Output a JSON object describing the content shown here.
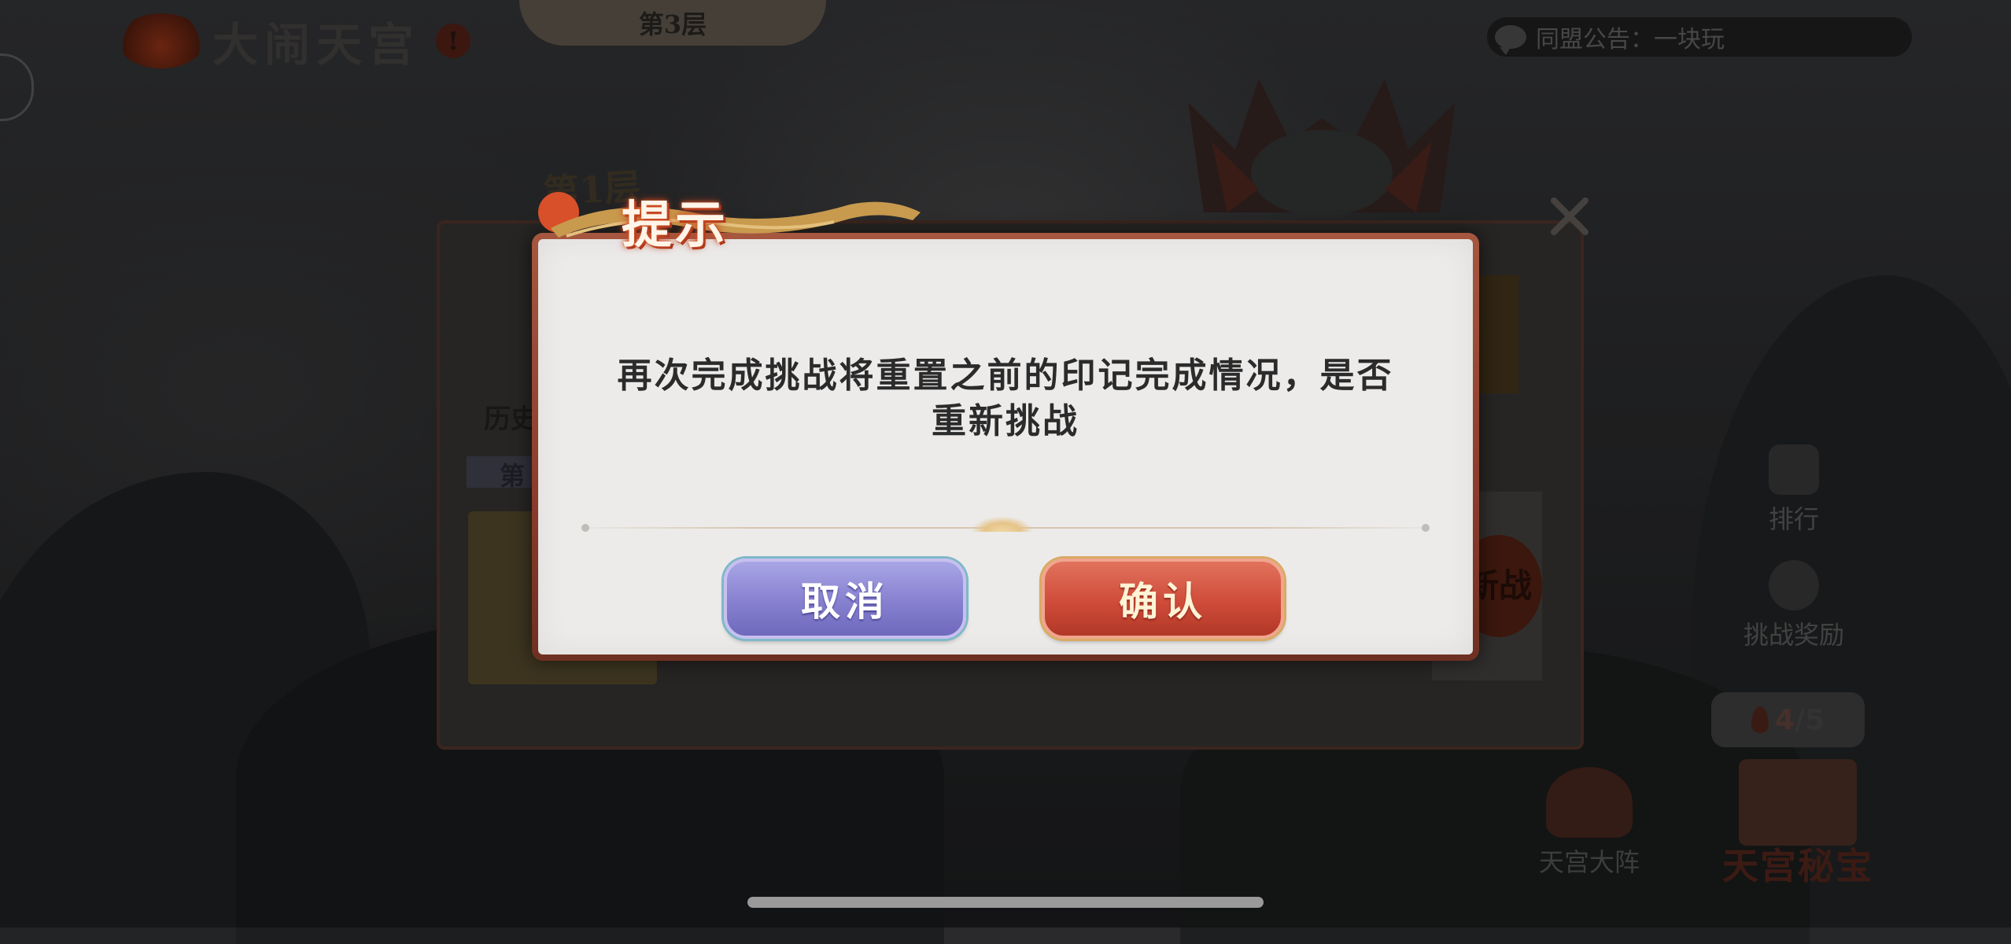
{
  "header": {
    "game_title": "大闹天宫",
    "alert_mark": "!",
    "floor_tab": "第3层",
    "announcement": "同盟公告：一块玩"
  },
  "background_panel": {
    "floor_label": "第1层",
    "history_label": "历史",
    "section_label": "第",
    "challenge_seal": "新战",
    "close_icon": "close-icon"
  },
  "side_menu": {
    "ranking_label": "排行",
    "reward_label": "挑战奖励",
    "stamina_current": "4",
    "stamina_max": "/5",
    "formation_label": "天宫大阵",
    "treasure_label": "天宫秘宝"
  },
  "modal": {
    "title": "提示",
    "message": "再次完成挑战将重置之前的印记完成情况，是否重新挑战",
    "cancel_label": "取消",
    "confirm_label": "确认"
  },
  "colors": {
    "modal_bg": "#ecebea",
    "modal_border": "#8c3c2c",
    "cancel_button": "#8680cf",
    "confirm_button": "#cf4b3a"
  }
}
